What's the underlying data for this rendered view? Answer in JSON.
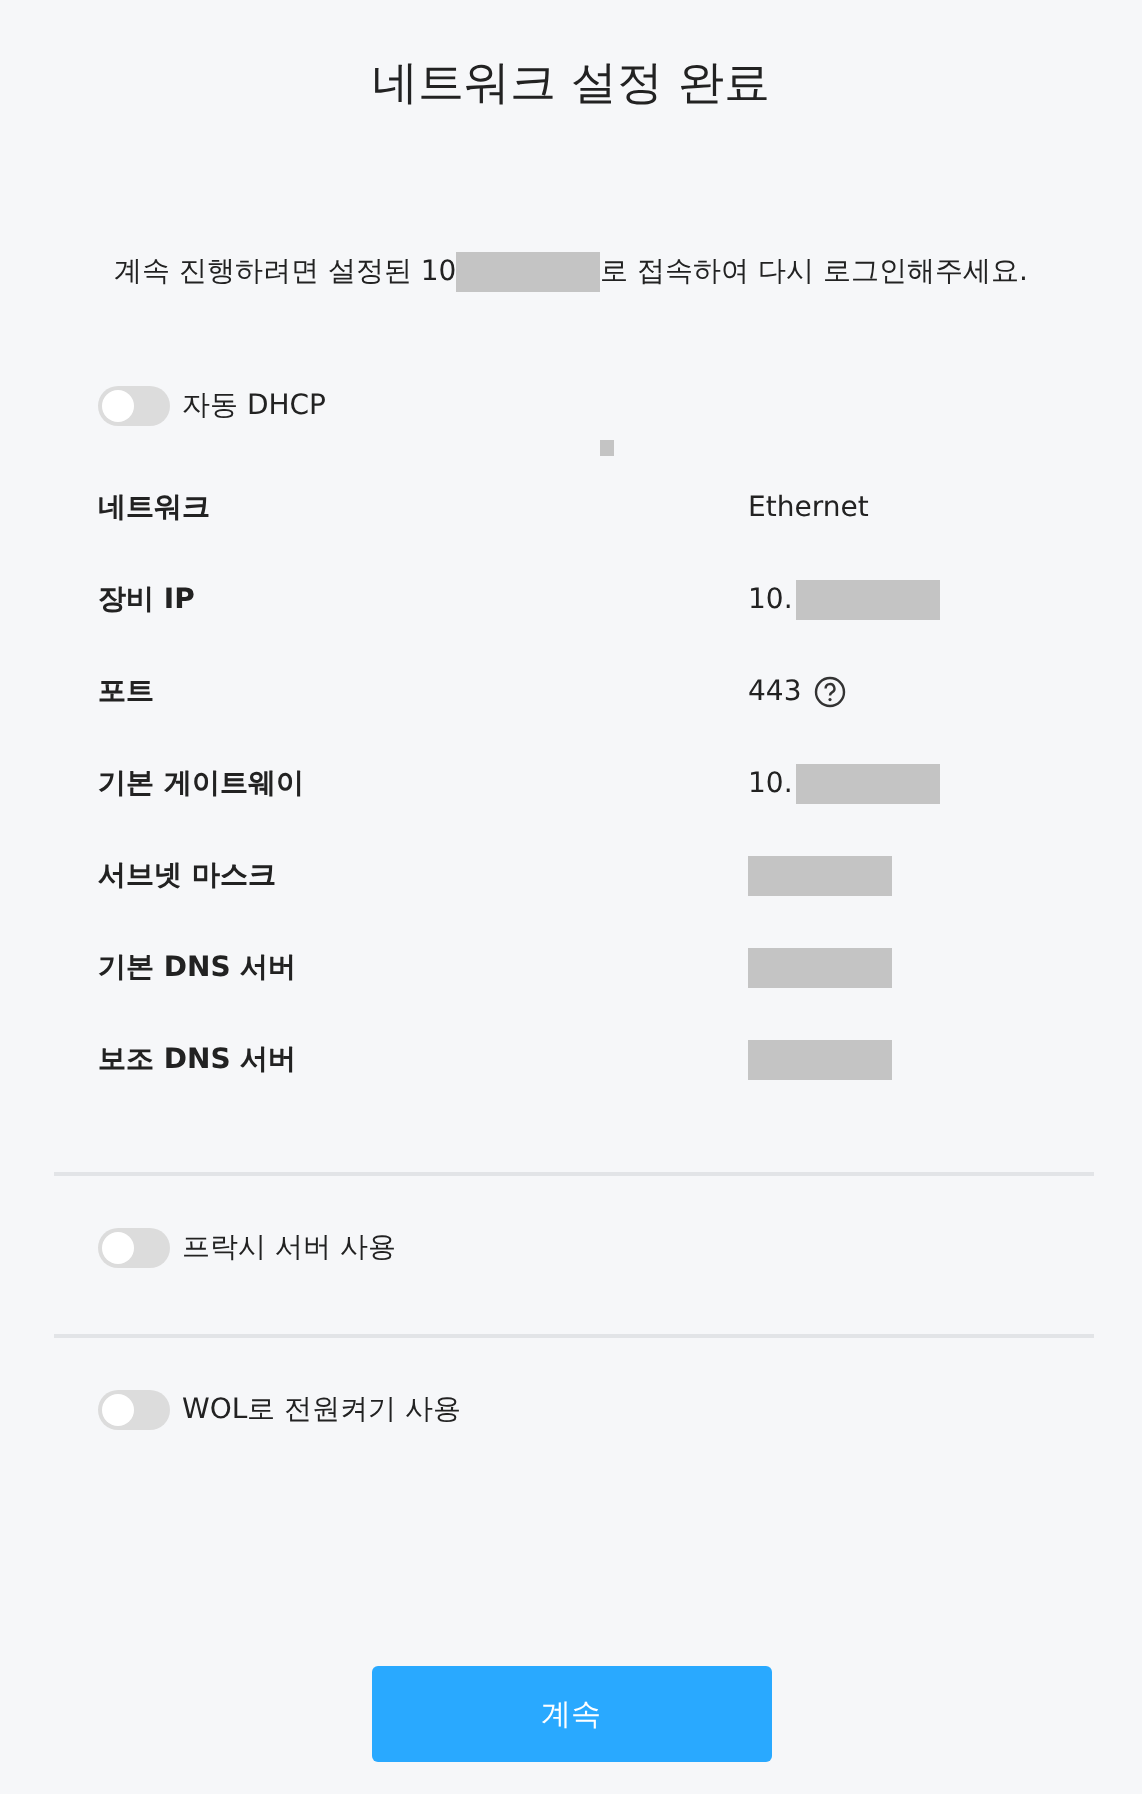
{
  "title": "네트워크 설정 완료",
  "message": {
    "before": "계속 진행하려면 설정된 10",
    "redacted": true,
    "after": "로 접속하여 다시 로그인해주세요."
  },
  "dhcp_toggle": {
    "label": "자동 DHCP",
    "on": false
  },
  "rows": [
    {
      "label": "네트워크",
      "value": "Ethernet",
      "redacted": false,
      "help": false
    },
    {
      "label": "장비 IP",
      "value": "10.",
      "redacted": true,
      "help": false
    },
    {
      "label": "포트",
      "value": "443",
      "redacted": false,
      "help": true
    },
    {
      "label": "기본 게이트웨이",
      "value": "10.",
      "redacted": true,
      "help": false
    },
    {
      "label": "서브넷 마스크",
      "redacted": true,
      "help": false
    },
    {
      "label": "기본 DNS 서버",
      "redacted": true,
      "help": false
    },
    {
      "label": "보조 DNS 서버",
      "redacted": true,
      "help": false
    }
  ],
  "sections": [
    {
      "label": "프락시 서버 사용",
      "on": false
    },
    {
      "label": "WOL로 전원켜기 사용",
      "on": false
    }
  ],
  "continue_button": "계속"
}
